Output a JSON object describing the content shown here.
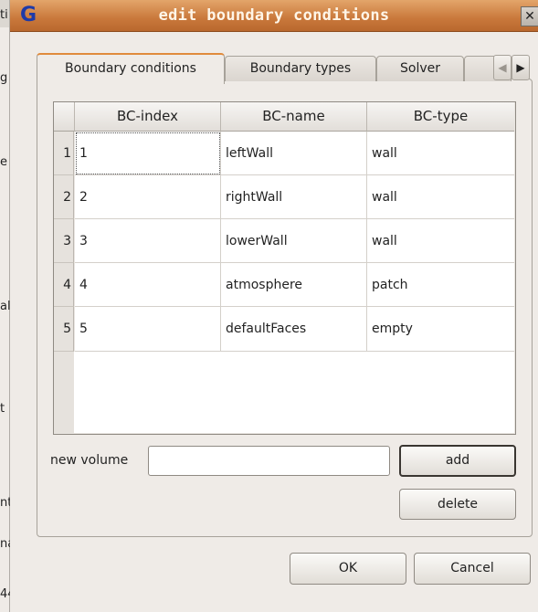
{
  "background_window": {
    "fragments": [
      "ti",
      "g",
      "e",
      "al",
      "t",
      "nt",
      "na",
      "44"
    ]
  },
  "dialog": {
    "title": "edit boundary conditions",
    "app_icon_letter": "G",
    "close_glyph": "✕",
    "tabs": [
      {
        "label": "Boundary conditions",
        "active": true
      },
      {
        "label": "Boundary types",
        "active": false
      },
      {
        "label": "Solver",
        "active": false
      }
    ],
    "tab_scroll_left": "◀",
    "tab_scroll_right": "▶",
    "table": {
      "columns": [
        "BC-index",
        "BC-name",
        "BC-type"
      ],
      "rows": [
        {
          "num": "1",
          "index": "1",
          "name": "leftWall",
          "type": "wall"
        },
        {
          "num": "2",
          "index": "2",
          "name": "rightWall",
          "type": "wall"
        },
        {
          "num": "3",
          "index": "3",
          "name": "lowerWall",
          "type": "wall"
        },
        {
          "num": "4",
          "index": "4",
          "name": "atmosphere",
          "type": "patch"
        },
        {
          "num": "5",
          "index": "5",
          "name": "defaultFaces",
          "type": "empty"
        }
      ]
    },
    "new_volume_label": "new volume",
    "new_volume_value": "",
    "add_label": "add",
    "delete_label": "delete",
    "ok_label": "OK",
    "cancel_label": "Cancel"
  },
  "colors": {
    "title_gradient_top": "#e3a56a",
    "title_gradient_bottom": "#b9682e",
    "active_tab_accent": "#e08a3c",
    "app_icon": "#1e3aa8"
  }
}
